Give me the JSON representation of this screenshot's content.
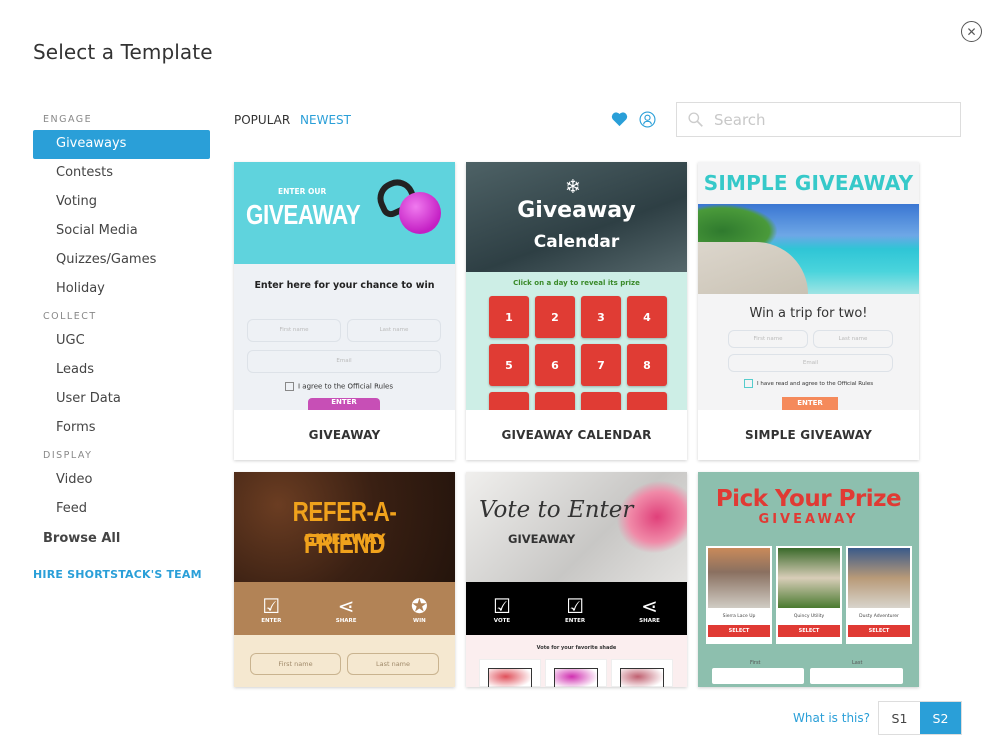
{
  "dialog": {
    "title": "Select a Template",
    "close_icon": "close-icon"
  },
  "sidebar": {
    "sections": [
      {
        "label": "ENGAGE",
        "items": [
          "Giveaways",
          "Contests",
          "Voting",
          "Social Media",
          "Quizzes/Games",
          "Holiday"
        ]
      },
      {
        "label": "COLLECT",
        "items": [
          "UGC",
          "Leads",
          "User Data",
          "Forms"
        ]
      },
      {
        "label": "DISPLAY",
        "items": [
          "Video",
          "Feed"
        ]
      }
    ],
    "active_item": "Giveaways",
    "browse_all": "Browse All",
    "hire_link": "HIRE SHORTSTACK'S TEAM"
  },
  "toolbar": {
    "sort_popular": "POPULAR",
    "sort_newest": "NEWEST",
    "favorites_icon": "heart-icon",
    "my_templates_icon": "user-icon",
    "search_placeholder": "Search",
    "accent_color": "#2a9fd8"
  },
  "templates": [
    {
      "name": "GIVEAWAY",
      "preview": {
        "kicker": "ENTER OUR",
        "headline": "GIVEAWAY",
        "subhead": "Enter here for your chance to win",
        "first": "First name",
        "last": "Last name",
        "email": "Email",
        "agree": "I agree to the Official Rules",
        "button": "ENTER"
      }
    },
    {
      "name": "GIVEAWAY CALENDAR",
      "preview": {
        "headline": "Giveaway",
        "headline2": "Calendar",
        "subhead": "Click on a day to reveal its prize",
        "days": [
          "1",
          "2",
          "3",
          "4",
          "5",
          "6",
          "7",
          "8",
          "",
          "",
          "",
          ""
        ]
      }
    },
    {
      "name": "SIMPLE GIVEAWAY",
      "preview": {
        "headline": "SIMPLE GIVEAWAY",
        "subhead": "Win a trip for two!",
        "first": "First name",
        "last": "Last name",
        "email": "Email",
        "agree": "I have read and agree to the Official Rules",
        "button": "ENTER"
      }
    },
    {
      "name": "REFER-A-FRIEND",
      "preview": {
        "headline": "REFER-A-FRIEND",
        "subhead": "GIVEAWAY",
        "steps": [
          "ENTER",
          "SHARE",
          "WIN"
        ],
        "first": "First name",
        "last": "Last name"
      }
    },
    {
      "name": "VOTE TO ENTER",
      "preview": {
        "headline": "Vote to Enter",
        "subhead": "GIVEAWAY",
        "steps": [
          "VOTE",
          "ENTER",
          "SHARE"
        ],
        "prompt": "Vote for your favorite shade"
      }
    },
    {
      "name": "PICK YOUR PRIZE",
      "preview": {
        "headline": "Pick Your Prize",
        "subhead": "GIVEAWAY",
        "prizes": [
          "Sierra Lace Up",
          "Quincy Utility",
          "Dusty Adventurer"
        ],
        "select": "SELECT",
        "first": "First",
        "last": "Last"
      }
    }
  ],
  "footer": {
    "help_link": "What is this?",
    "seg_options": [
      "S1",
      "S2"
    ],
    "seg_selected": "S2"
  }
}
